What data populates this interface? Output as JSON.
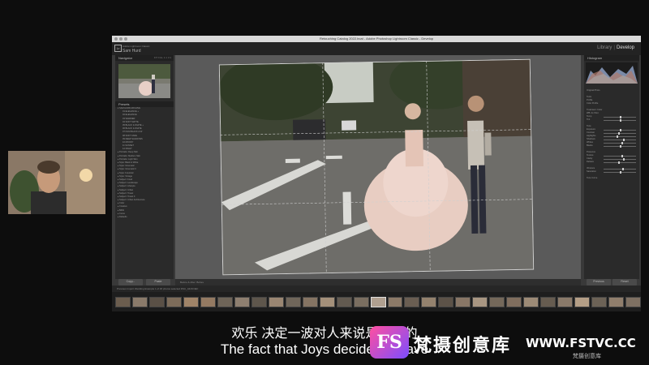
{
  "window": {
    "title": "Retouching Catalog 2022.lrcat - Adobe Photoshop Lightroom Classic - Develop",
    "identity_small": "Adobe Lightroom Classic",
    "identity_name": "Sam Hurd"
  },
  "modules": {
    "library": "Library",
    "separator": "|",
    "develop": "Develop"
  },
  "left_panel": {
    "navigator_label": "Navigator",
    "navigator_zoom": "FIT  FILL  1:1  3:1",
    "presets_label": "Presets",
    "preset_rows": [
      {
        "type": "grp",
        "label": "▾ SAM HURD ARCHIVE"
      },
      {
        "type": "item",
        "label": "01 ELEGANCE +"
      },
      {
        "type": "item",
        "label": "02 ELEGANCE"
      },
      {
        "type": "item",
        "label": "03 WARMER"
      },
      {
        "type": "item",
        "label": "04 SOFT MATTE"
      },
      {
        "type": "item",
        "label": "05 BLACK & WHITE +"
      },
      {
        "type": "item",
        "label": "06 BLACK & WHITE"
      },
      {
        "type": "item",
        "label": "07 FILM BLACK & W"
      },
      {
        "type": "item",
        "label": "08 SOFT FADE"
      },
      {
        "type": "item",
        "label": "09 DEEP SHADOWS"
      },
      {
        "type": "item",
        "label": "10 MOODY"
      },
      {
        "type": "item",
        "label": "11 SUNSET"
      },
      {
        "type": "item",
        "label": "12 NIGHT"
      },
      {
        "type": "grp",
        "label": "▸ Portraits: Deep Skin"
      },
      {
        "type": "grp",
        "label": "▸ Portraits: Medium Skin"
      },
      {
        "type": "grp",
        "label": "▸ Portraits: Light Skin"
      },
      {
        "type": "grp",
        "label": "▸ Style: Black & White"
      },
      {
        "type": "grp",
        "label": "▸ Style: Cinematic"
      },
      {
        "type": "grp",
        "label": "▸ Style: Cinematic II"
      },
      {
        "type": "grp",
        "label": "▸ Style: Futuristic"
      },
      {
        "type": "grp",
        "label": "▸ Style: Vintage"
      },
      {
        "type": "grp",
        "label": "▸ Subject: Food"
      },
      {
        "type": "grp",
        "label": "▸ Subject: Landscape"
      },
      {
        "type": "grp",
        "label": "▸ Subject: Lifestyle"
      },
      {
        "type": "grp",
        "label": "▸ Subject: Urban"
      },
      {
        "type": "grp",
        "label": "▸ Subject: Travel"
      },
      {
        "type": "grp",
        "label": "▸ Subject: Travel II"
      },
      {
        "type": "grp",
        "label": "▸ Subject: Urban Architecture"
      },
      {
        "type": "grp",
        "label": "▸ Color"
      },
      {
        "type": "grp",
        "label": "▸ Creative"
      },
      {
        "type": "grp",
        "label": "▸ B&W"
      },
      {
        "type": "grp",
        "label": "▸ Curve"
      },
      {
        "type": "grp",
        "label": "▸ Defaults"
      }
    ],
    "copy_label": "Copy...",
    "paste_label": "Paste"
  },
  "toolbar": {
    "label": "Before & After:  Before"
  },
  "right_panel": {
    "histogram_label": "Histogram",
    "rows": [
      "Original Photo",
      "",
      "Tools",
      "Profile",
      "Color Profile",
      "",
      "Treatment: Color",
      "WB: As Shot",
      "Temp",
      "Tint",
      "",
      "Tone",
      "Exposure",
      "Contrast",
      "Highlights",
      "Shadows",
      "Whites",
      "Blacks",
      "",
      "Presence",
      "Texture",
      "Clarity",
      "Dehaze",
      "",
      "Vibrance",
      "Saturation",
      "",
      "Tone Curve"
    ],
    "previous_label": "Previous",
    "reset_label": "Reset"
  },
  "filmstrip_header": {
    "text": "Previous Import   Wedding Example   1 of 36 photos   selected   DSC_4418.NEF"
  },
  "subtitles": {
    "chinese": "欢乐 决定一波对人来说是非常的",
    "english": "The fact that Joys decides a wave"
  },
  "watermark": {
    "logo": "FS",
    "name": "梵摄创意库",
    "url": "WWW.FSTVC.CC",
    "small": "梵摄创意库"
  },
  "colors": {
    "accent": "#ff4fa0",
    "panel_bg": "#2a2a2a",
    "canvas_bg": "#5a5a5a"
  }
}
